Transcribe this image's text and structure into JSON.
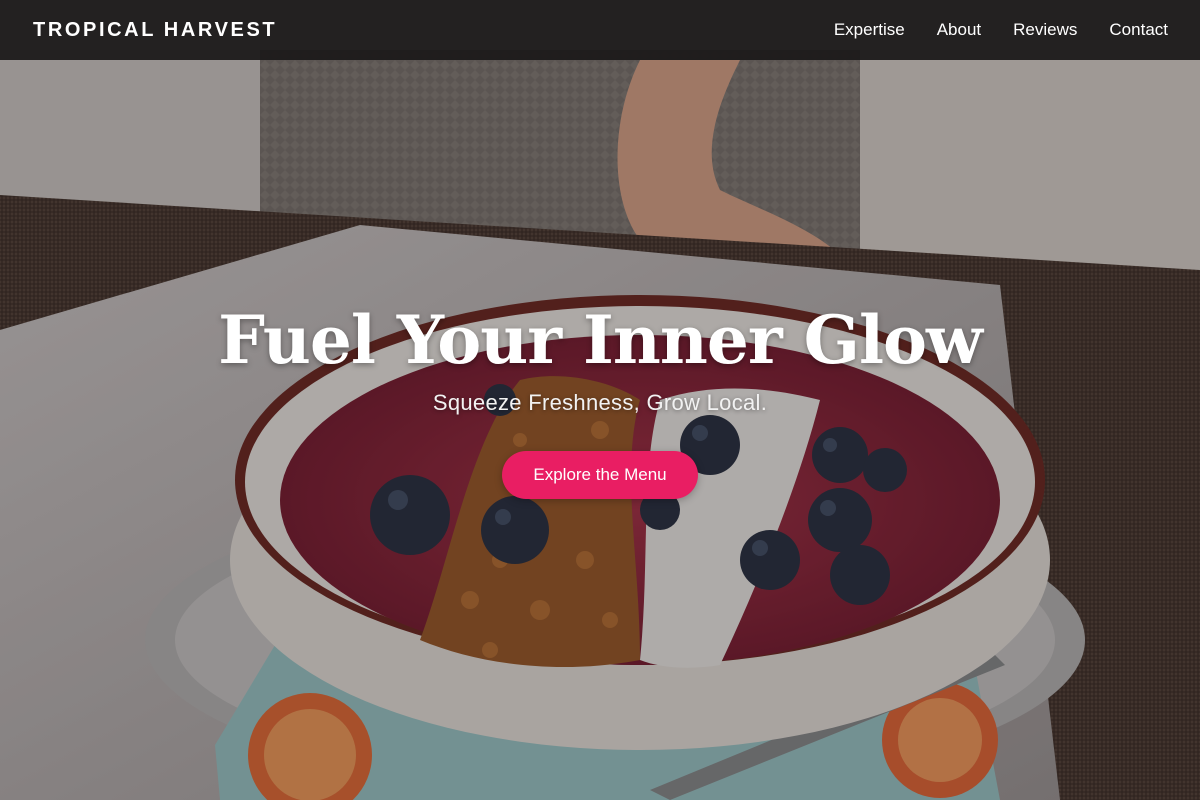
{
  "navbar": {
    "brand": "TROPICAL HARVEST",
    "links": [
      "Expertise",
      "About",
      "Reviews",
      "Contact"
    ]
  },
  "hero": {
    "title": "Fuel Your Inner Glow",
    "subtitle": "Squeeze Freshness, Grow Local.",
    "cta_label": "Explore the Menu"
  },
  "colors": {
    "accent": "#e91e63",
    "navbar_bg": "#1c1a1a",
    "text": "#ffffff"
  }
}
